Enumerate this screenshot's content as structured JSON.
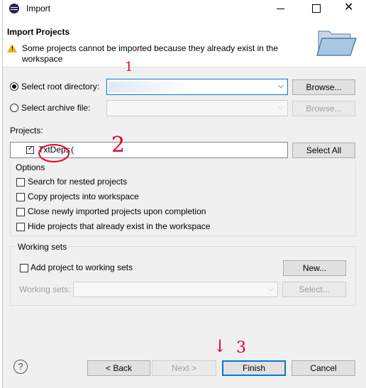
{
  "window": {
    "title": "Import"
  },
  "header": {
    "title": "Import Projects",
    "warning": "Some projects cannot be imported because they already exist in the",
    "warning_line2": "workspace"
  },
  "source": {
    "root_dir_label": "Select root directory:",
    "root_dir_value": "",
    "archive_label": "Select archive file:",
    "browse_label": "Browse...",
    "browse_disabled_label": "Browse..."
  },
  "projects": {
    "label": "Projects:",
    "items": [
      {
        "name": "TxtDeps",
        "suffix": "("
      }
    ],
    "select_all_label": "Select All"
  },
  "options": {
    "title": "Options",
    "items": [
      "Search for nested projects",
      "Copy projects into workspace",
      "Close newly imported projects upon completion",
      "Hide projects that already exist in the workspace"
    ]
  },
  "working_sets": {
    "title": "Working sets",
    "add_label": "Add project to working sets",
    "new_label": "New...",
    "sets_label": "Working sets:",
    "select_label": "Select..."
  },
  "footer": {
    "help": "?",
    "back": "< Back",
    "next": "Next >",
    "finish": "Finish",
    "cancel": "Cancel"
  },
  "annotations": {
    "one": "1",
    "two": "2",
    "three": "3",
    "arrow": "↓"
  },
  "colors": {
    "annotation": "#e4002b",
    "accent": "#0078d7",
    "warning": "#f2b01e"
  }
}
